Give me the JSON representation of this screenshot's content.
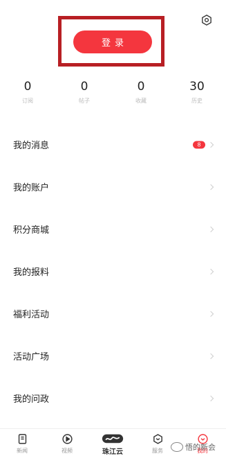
{
  "header": {
    "settings_icon": "gear-icon",
    "login_label": "登录"
  },
  "stats": [
    {
      "value": "0",
      "label": "订阅"
    },
    {
      "value": "0",
      "label": "帖子"
    },
    {
      "value": "0",
      "label": "收藏"
    },
    {
      "value": "30",
      "label": "历史"
    }
  ],
  "menu": [
    {
      "label": "我的消息",
      "badge": "8"
    },
    {
      "label": "我的账户"
    },
    {
      "label": "积分商城"
    },
    {
      "label": "我的报料"
    },
    {
      "label": "福利活动"
    },
    {
      "label": "活动广场"
    },
    {
      "label": "我的问政"
    }
  ],
  "tabbar": [
    {
      "label": "新闻",
      "icon": "news-icon"
    },
    {
      "label": "视频",
      "icon": "video-play-icon"
    },
    {
      "label": "珠江云",
      "icon": "cloud-logo-icon"
    },
    {
      "label": "服务",
      "icon": "service-icon"
    },
    {
      "label": "我的",
      "icon": "profile-icon",
      "active": true
    }
  ],
  "watermark": "悟的新会",
  "colors": {
    "accent": "#f4363e",
    "highlight_frame": "#b81f24"
  }
}
